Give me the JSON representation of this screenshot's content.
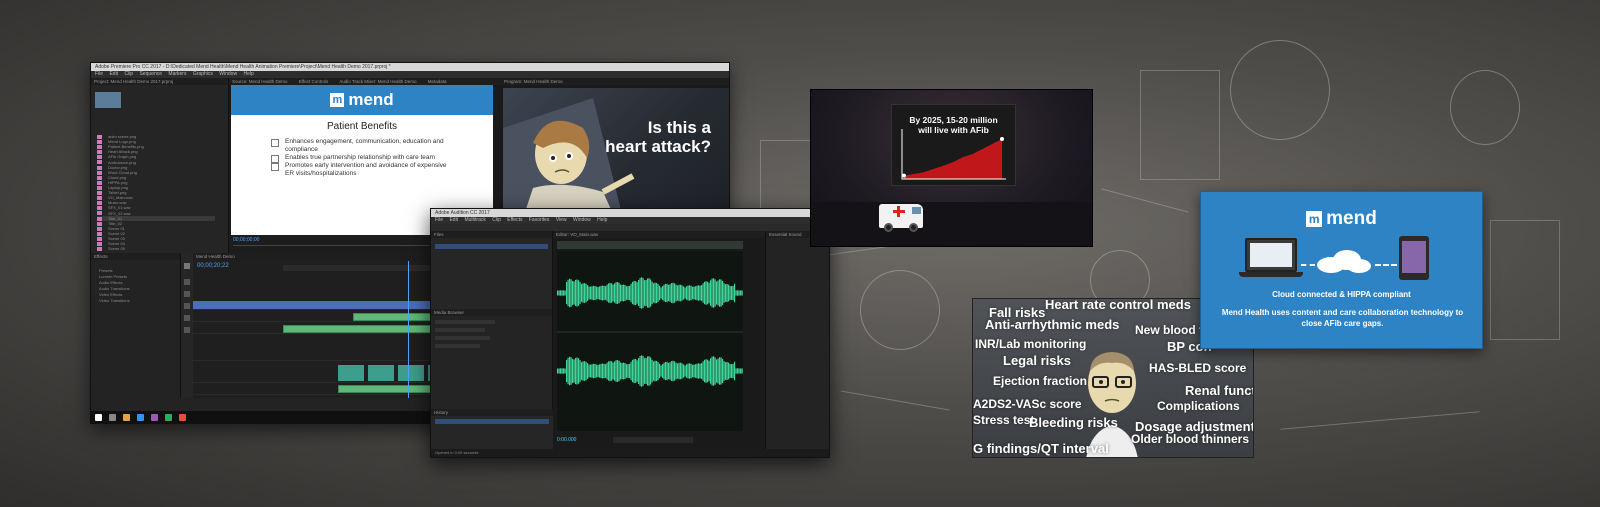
{
  "premiere": {
    "title": "Adobe Premiere Pro CC 2017 - D:\\Dedicated Mend Health\\Mend Health Animation Premiere\\Project\\Mend Health Demo 2017.prproj *",
    "menu": [
      "File",
      "Edit",
      "Clip",
      "Sequence",
      "Markers",
      "Graphics",
      "Window",
      "Help"
    ],
    "source_tabs": [
      "Source: Mend Health Demo",
      "Effect Controls",
      "Audio Track Mixer: Mend Health Demo",
      "Metadata"
    ],
    "program_tab": "Program: Mend Health Demo",
    "project_tab": "Project: Mend Health Demo 2017.prproj",
    "timeline_tab": "Mend Health Demo",
    "source_timecode": "00;00;00;00",
    "timeline_timecode": "00;00;20;22",
    "effects_tab": "Effects",
    "effects_items": [
      "Presets",
      "Lumetri Presets",
      "Audio Effects",
      "Audio Transitions",
      "Video Effects",
      "Video Transitions"
    ],
    "project_items": [
      "anim scene.png",
      "Mend Logo.png",
      "Patient Benefits.png",
      "Heart Attack.png",
      "AFib Graph.png",
      "Ambulance.png",
      "Doctor.png",
      "Word Cloud.png",
      "Cloud.png",
      "HIPPA.png",
      "Laptop.png",
      "Tablet.png",
      "VO_Main.wav",
      "Music.wav",
      "SFX_01.wav",
      "SFX_02.wav",
      "Title_01",
      "Title_02",
      "Scene 01",
      "Scene 02",
      "Scene 03",
      "Scene 04",
      "Scene 05"
    ]
  },
  "slide": {
    "logo_text": "mend",
    "heading": "Patient Benefits",
    "bullets": [
      "Enhances engagement, communication, education and compliance",
      "Enables true partnership relationship with care team",
      "Promotes early intervention and avoidance of expensive ER visits/hospitalizations"
    ]
  },
  "anim1": {
    "line1": "Is this a",
    "line2": "heart attack?"
  },
  "audition": {
    "title": "Adobe Audition CC 2017",
    "menu": [
      "File",
      "Edit",
      "Multitrack",
      "Clip",
      "Effects",
      "Favorites",
      "View",
      "Window",
      "Help"
    ],
    "files_tab": "Files",
    "media_tab": "Media Browser",
    "history_tab": "History",
    "editor_tab": "Editor: VO_Main.wav",
    "timecode": "0:00.000",
    "status": "Opened in 0.09 seconds",
    "right_panel": "Essential Sound"
  },
  "afib": {
    "line1": "By 2025, 15-20 million",
    "line2": "will live with AFib",
    "chart_data": {
      "type": "area",
      "x": [
        0,
        1,
        2,
        3,
        4,
        5,
        6,
        7,
        8,
        9,
        10
      ],
      "values": [
        2,
        3,
        4,
        6,
        8,
        10,
        13,
        15,
        18,
        21,
        24
      ],
      "title": "",
      "xlabel": "",
      "ylabel": ""
    },
    "fill_color": "#c0171b"
  },
  "word_cloud": [
    {
      "text": "Fall risks",
      "size": 13
    },
    {
      "text": "Heart rate control meds",
      "size": 13
    },
    {
      "text": "Anti-arrhythmic meds",
      "size": 13
    },
    {
      "text": "New blood t",
      "size": 12
    },
    {
      "text": "INR/Lab monitoring",
      "size": 12
    },
    {
      "text": "BP con",
      "size": 13
    },
    {
      "text": "Legal risks",
      "size": 13
    },
    {
      "text": "HAS-BLED score",
      "size": 12
    },
    {
      "text": "Ejection fraction",
      "size": 12
    },
    {
      "text": "Renal funct",
      "size": 13
    },
    {
      "text": "A2DS2-VASc score",
      "size": 12
    },
    {
      "text": "Complications",
      "size": 12
    },
    {
      "text": "Stress test",
      "size": 12
    },
    {
      "text": "Bleeding risks",
      "size": 13
    },
    {
      "text": "Dosage adjustment",
      "size": 13
    },
    {
      "text": "Older blood thinners",
      "size": 12
    },
    {
      "text": "G findings/QT interval",
      "size": 13
    }
  ],
  "cloud_panel": {
    "logo_text": "mend",
    "line1": "Cloud connected & HIPPA compliant",
    "line2": "Mend Health uses content and care collaboration technology to close AFib care gaps."
  },
  "colors": {
    "mend_blue": "#2e83c5",
    "waveform": "#3fd69a",
    "timecode_blue": "#4da3ff"
  }
}
